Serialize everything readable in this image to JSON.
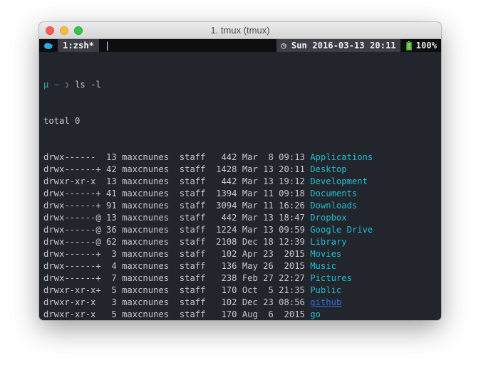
{
  "window": {
    "title": "1. tmux (tmux)"
  },
  "statusbar": {
    "session_icon": "bird-icon",
    "window_tab": "1:zsh*",
    "pane_marker": "|",
    "clock": "◷ Sun 2016-03-13 20:11",
    "battery_icon": "battery-icon",
    "battery_level": "100%"
  },
  "terminal": {
    "prompt_symbol": "μ",
    "prompt_path": "~",
    "prompt_arrow": "❯",
    "command": "ls -l",
    "total": "total 0",
    "entries": [
      {
        "meta": "drwx------  13 maxcnunes  staff   442 Mar  8 09:13 ",
        "name": "Applications"
      },
      {
        "meta": "drwx------+ 42 maxcnunes  staff  1428 Mar 13 20:11 ",
        "name": "Desktop"
      },
      {
        "meta": "drwxr-xr-x  13 maxcnunes  staff   442 Mar 13 19:12 ",
        "name": "Development"
      },
      {
        "meta": "drwx------+ 41 maxcnunes  staff  1394 Mar 11 09:18 ",
        "name": "Documents"
      },
      {
        "meta": "drwx------+ 91 maxcnunes  staff  3094 Mar 11 16:26 ",
        "name": "Downloads"
      },
      {
        "meta": "drwx------@ 13 maxcnunes  staff   442 Mar 13 18:47 ",
        "name": "Dropbox"
      },
      {
        "meta": "drwx------@ 36 maxcnunes  staff  1224 Mar 13 09:59 ",
        "name": "Google Drive"
      },
      {
        "meta": "drwx------@ 62 maxcnunes  staff  2108 Dec 18 12:39 ",
        "name": "Library"
      },
      {
        "meta": "drwx------+  3 maxcnunes  staff   102 Apr 23  2015 ",
        "name": "Movies"
      },
      {
        "meta": "drwx------+  4 maxcnunes  staff   136 May 26  2015 ",
        "name": "Music"
      },
      {
        "meta": "drwx------+  7 maxcnunes  staff   238 Feb 27 22:27 ",
        "name": "Pictures"
      },
      {
        "meta": "drwxr-xr-x+  5 maxcnunes  staff   170 Oct  5 21:35 ",
        "name": "Public"
      },
      {
        "meta": "drwxr-xr-x   3 maxcnunes  staff   102 Dec 23 08:56 ",
        "name": "github"
      },
      {
        "meta": "drwxr-xr-x   5 maxcnunes  staff   170 Aug  6  2015 ",
        "name": "go"
      }
    ]
  },
  "colors": {
    "terminal_bg": "#22252c",
    "statusbar_bg": "#0d0e10",
    "tab_bg": "#3b3e44",
    "directory": "#1fbfd0",
    "link_directory": "#2f6fe0",
    "prompt": "#2db5b9",
    "battery": "#5fbf3a"
  }
}
